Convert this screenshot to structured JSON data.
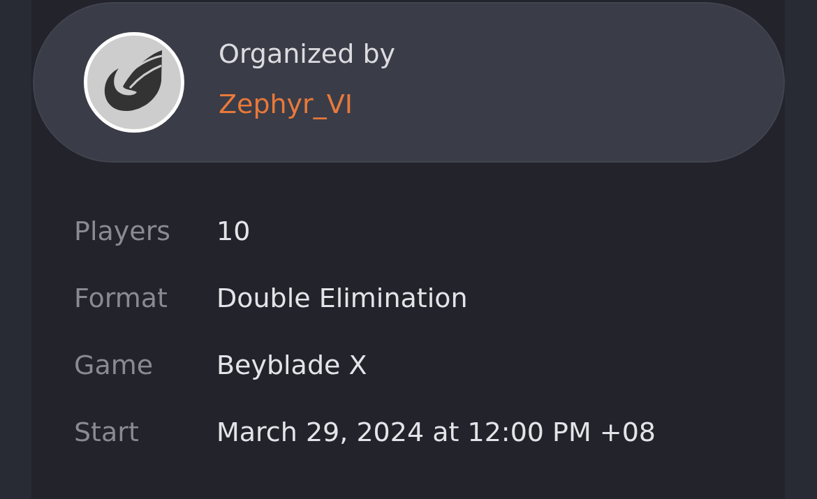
{
  "organizer": {
    "label": "Organized by",
    "name": "Zephyr_VI"
  },
  "details": [
    {
      "label": "Players",
      "value": "10"
    },
    {
      "label": "Format",
      "value": "Double Elimination"
    },
    {
      "label": "Game",
      "value": "Beyblade X"
    },
    {
      "label": "Start",
      "value": "March 29, 2024 at 12:00 PM +08"
    }
  ]
}
